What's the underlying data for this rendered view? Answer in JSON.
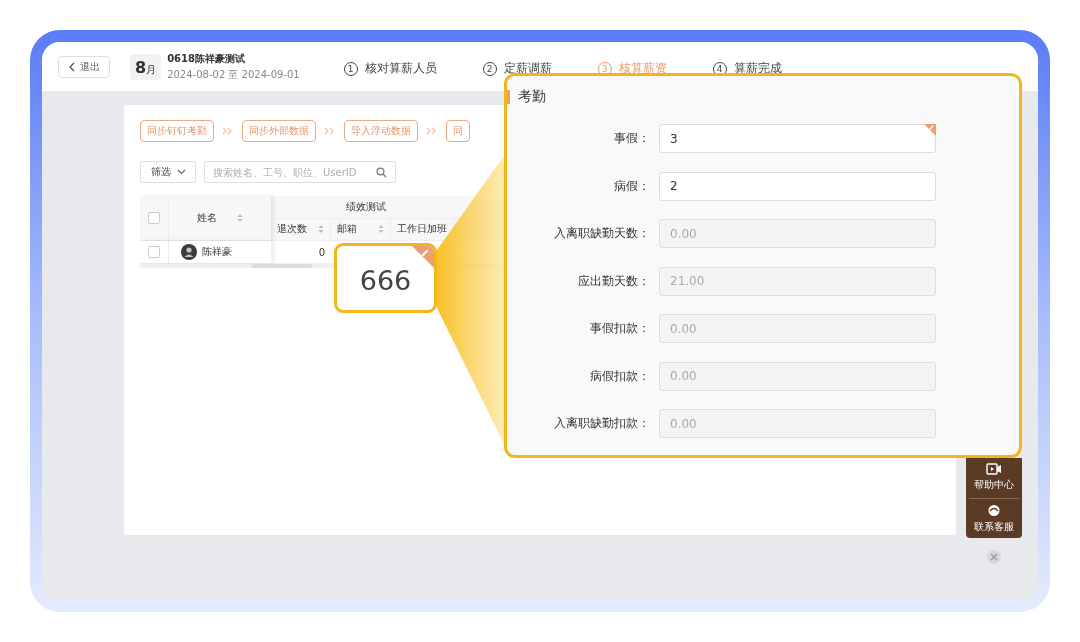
{
  "header": {
    "back": "退出",
    "month_num": "8",
    "month_unit": "月",
    "title": "0618陈祥豪测试",
    "period": "2024-08-02 至 2024-09-01"
  },
  "steps": [
    {
      "number": "1",
      "label": "核对算薪人员",
      "selected": false
    },
    {
      "number": "2",
      "label": "定薪调薪",
      "selected": false
    },
    {
      "number": "3",
      "label": "核算薪资",
      "selected": true
    },
    {
      "number": "4",
      "label": "算薪完成",
      "selected": false
    }
  ],
  "actions": [
    "同步钉钉考勤",
    "同步外部数据",
    "导入浮动数据",
    "同"
  ],
  "filter": {
    "label": "筛选"
  },
  "search": {
    "placeholder": "搜索姓名、工号、职位、UserID"
  },
  "table": {
    "all_checked": false,
    "name_column": "姓名",
    "group": "绩效测试",
    "columns": [
      "退次数",
      "邮箱",
      "工作日加班"
    ],
    "rows": [
      {
        "name": "陈祥豪",
        "checked": false,
        "cells": [
          "0"
        ]
      }
    ]
  },
  "callout": {
    "value": "666",
    "edited": true
  },
  "panel": {
    "title": "考勤",
    "fields": [
      {
        "label": "事假：",
        "value": "3",
        "kind": "editable",
        "edited": true
      },
      {
        "label": "病假：",
        "value": "2",
        "kind": "editable",
        "edited": false
      },
      {
        "label": "入离职缺勤天数：",
        "value": "0.00",
        "kind": "readonly",
        "edited": false
      },
      {
        "label": "应出勤天数：",
        "value": "21.00",
        "kind": "readonly",
        "edited": false
      },
      {
        "label": "事假扣款：",
        "value": "0.00",
        "kind": "readonly",
        "edited": false
      },
      {
        "label": "病假扣款：",
        "value": "0.00",
        "kind": "readonly",
        "edited": false
      },
      {
        "label": "入离职缺勤扣款：",
        "value": "0.00",
        "kind": "readonly",
        "edited": false
      }
    ]
  },
  "help": [
    {
      "kind": "video",
      "label": "帮助中心"
    },
    {
      "kind": "headset",
      "label": "联系客服"
    }
  ]
}
